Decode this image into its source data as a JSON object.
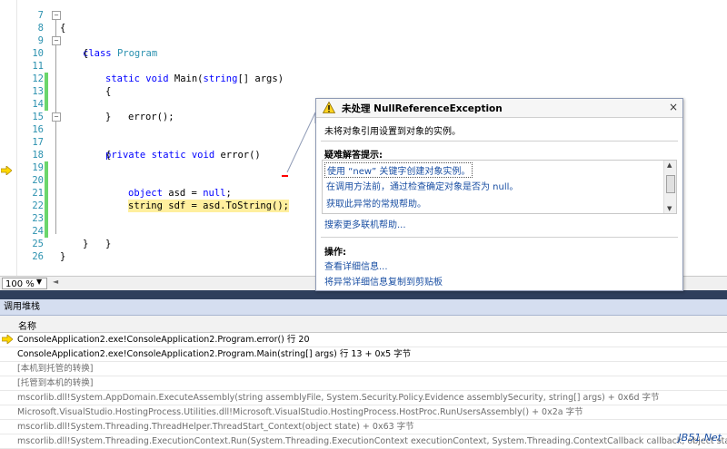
{
  "editor": {
    "lines": [
      {
        "n": "7",
        "text": "{"
      },
      {
        "n": "8",
        "text": "class Program"
      },
      {
        "n": "9",
        "text": "{"
      },
      {
        "n": "10",
        "text": "static void Main(string[] args)"
      },
      {
        "n": "11",
        "text": "{"
      },
      {
        "n": "12",
        "text": ""
      },
      {
        "n": "13",
        "text": "error();"
      },
      {
        "n": "14",
        "text": "}"
      },
      {
        "n": "15",
        "text": ""
      },
      {
        "n": "16",
        "text": "private static void error()"
      },
      {
        "n": "17",
        "text": "{"
      },
      {
        "n": "18",
        "text": ""
      },
      {
        "n": "19",
        "text": "object asd = null;"
      },
      {
        "n": "20",
        "text": "string sdf = asd.ToString();"
      },
      {
        "n": "21",
        "text": ""
      },
      {
        "n": "22",
        "text": ""
      },
      {
        "n": "23",
        "text": "}"
      },
      {
        "n": "24",
        "text": "}"
      },
      {
        "n": "25",
        "text": "}"
      },
      {
        "n": "26",
        "text": ""
      }
    ],
    "zoom": "100 %"
  },
  "exception": {
    "title": "未处理 NullReferenceException",
    "close": "×",
    "message": "未将对象引用设置到对象的实例。",
    "tips_title": "疑难解答提示:",
    "tips": [
      "使用 “new” 关键字创建对象实例。",
      "在调用方法前，通过检查确定对象是否为 null。",
      "获取此异常的常规帮助。"
    ],
    "more_help": "搜索更多联机帮助...",
    "actions_title": "操作:",
    "actions": [
      "查看详细信息...",
      "将异常详细信息复制到剪贴板"
    ]
  },
  "callstack": {
    "title": "调用堆栈",
    "column": "名称",
    "rows": [
      "ConsoleApplication2.exe!ConsoleApplication2.Program.error() 行 20",
      "ConsoleApplication2.exe!ConsoleApplication2.Program.Main(string[] args) 行 13 + 0x5 字节",
      "[本机到托管的转换]",
      "[托管到本机的转换]",
      "mscorlib.dll!System.AppDomain.ExecuteAssembly(string assemblyFile, System.Security.Policy.Evidence assemblySecurity, string[] args) + 0x6d 字节",
      "Microsoft.VisualStudio.HostingProcess.Utilities.dll!Microsoft.VisualStudio.HostingProcess.HostProc.RunUsersAssembly() + 0x2a 字节",
      "mscorlib.dll!System.Threading.ThreadHelper.ThreadStart_Context(object state) + 0x63 字节",
      "mscorlib.dll!System.Threading.ExecutionContext.Run(System.Threading.ExecutionContext executionContext, System.Threading.ContextCallback callback, object state)"
    ]
  },
  "watermark": "JB51.Net"
}
